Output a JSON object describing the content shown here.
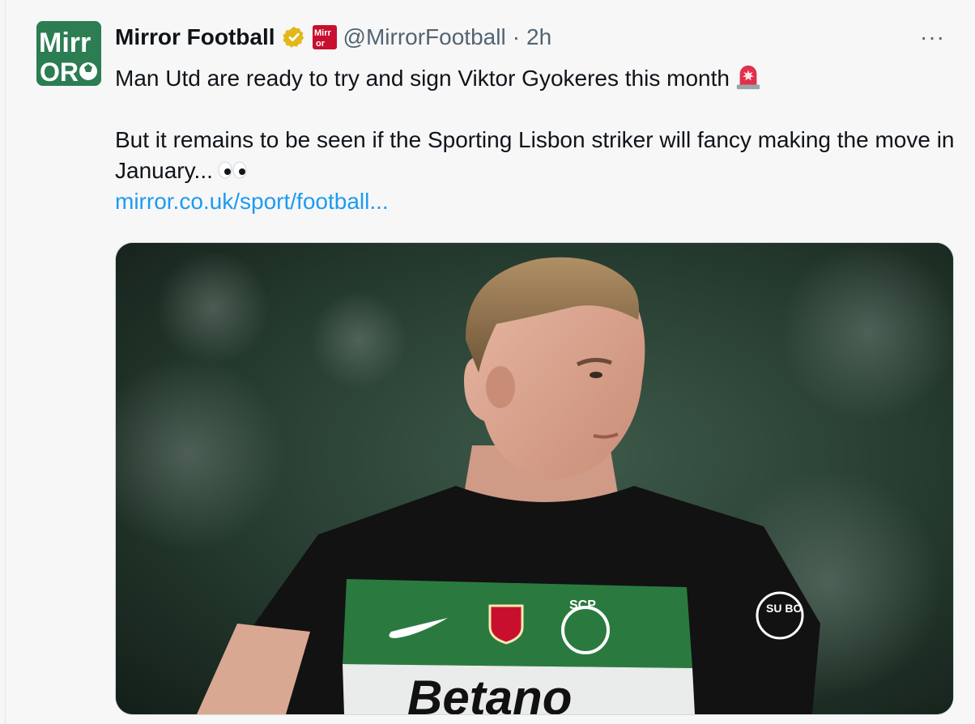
{
  "tweet": {
    "author_name": "Mirror Football",
    "handle": "@MirrorFootball",
    "separator": "·",
    "time": "2h",
    "more_label": "···",
    "avatar": {
      "logo_top": "Mirr",
      "logo_bottom": "OR"
    },
    "affiliate_badge": "Mirr or",
    "line1": "Man Utd are ready to try and sign Viktor Gyokeres this month",
    "line2": "But it remains to be seen if the Sporting Lisbon striker will fancy making the move in January...",
    "link_text": "mirror.co.uk/sport/football...",
    "media": {
      "description_icon": "photo",
      "shirt_sponsor": "Betano",
      "crest_text": "SCP",
      "sleeve_badge": "SU BO"
    }
  },
  "colors": {
    "link": "#1d9bf0",
    "verified_gold": "#e2b719",
    "avatar_green": "#2c7d52",
    "secondary_text": "#536471"
  },
  "icons": {
    "verified": "verified-gold-badge-icon",
    "alert": "rotating-light-emoji-icon",
    "eyes": "eyes-emoji-icon",
    "more": "more-horizontal-icon"
  }
}
